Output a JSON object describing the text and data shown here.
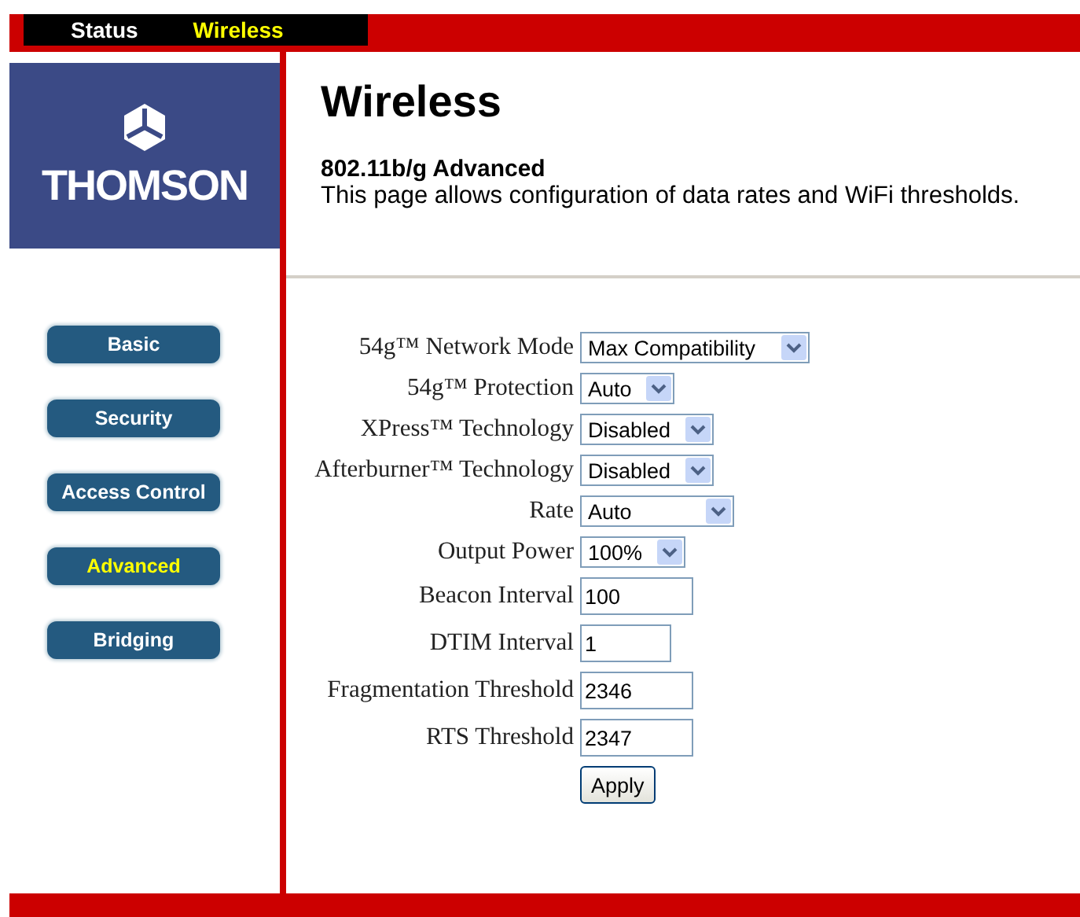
{
  "top_tabs": [
    {
      "label": "Status",
      "selected": false
    },
    {
      "label": "Wireless",
      "selected": true
    }
  ],
  "logo": {
    "text": "THOMSON"
  },
  "sidebar": {
    "items": [
      {
        "label": "Basic",
        "selected": false
      },
      {
        "label": "Security",
        "selected": false
      },
      {
        "label": "Access Control",
        "selected": false
      },
      {
        "label": "Advanced",
        "selected": true
      },
      {
        "label": "Bridging",
        "selected": false
      }
    ]
  },
  "page": {
    "title": "Wireless",
    "subtitle": "802.11b/g Advanced",
    "description": "This page allows configuration of data rates and WiFi thresholds."
  },
  "form": {
    "fields": [
      {
        "label": "54g™ Network Mode",
        "kind": "select",
        "value": "Max Compatibility"
      },
      {
        "label": "54g™ Protection",
        "kind": "select",
        "value": "Auto"
      },
      {
        "label": "XPress™ Technology",
        "kind": "select",
        "value": "Disabled"
      },
      {
        "label": "Afterburner™ Technology",
        "kind": "select",
        "value": "Disabled"
      },
      {
        "label": "Rate",
        "kind": "select",
        "value": "Auto"
      },
      {
        "label": "Output Power",
        "kind": "select",
        "value": "100%"
      },
      {
        "label": "Beacon Interval",
        "kind": "text",
        "value": "100"
      },
      {
        "label": "DTIM Interval",
        "kind": "text",
        "value": "1"
      },
      {
        "label": "Fragmentation Threshold",
        "kind": "text",
        "value": "2346"
      },
      {
        "label": "RTS Threshold",
        "kind": "text",
        "value": "2347"
      }
    ],
    "button": "Apply"
  }
}
